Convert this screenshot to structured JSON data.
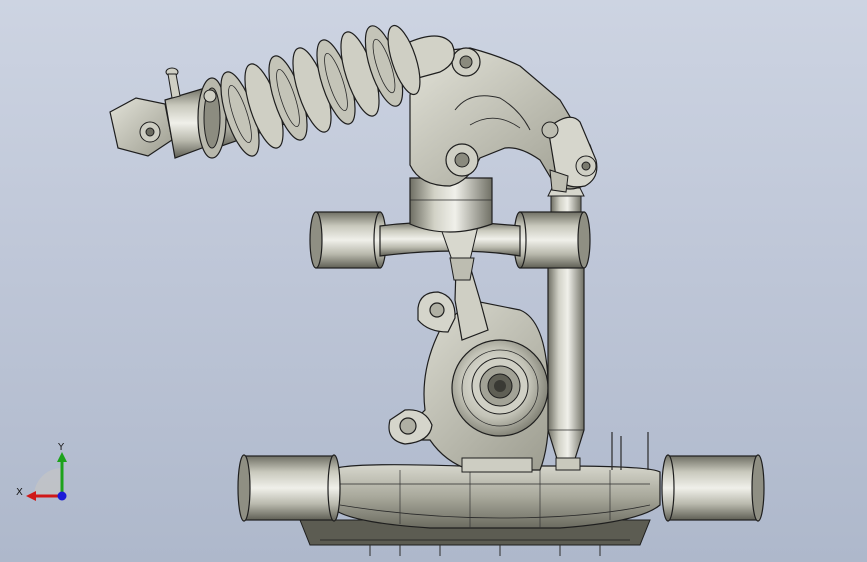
{
  "viewport": {
    "background_top": "#cdd4e2",
    "background_bottom": "#aeb8cb"
  },
  "model": {
    "parts": [
      "shock-absorber",
      "coil-spring",
      "rocker-arm",
      "upper-control-arm",
      "upright-knuckle",
      "wheel-hub",
      "pushrod",
      "lower-control-arm"
    ],
    "metal_light": "#e9e9e2",
    "metal_mid": "#b9b9ad",
    "metal_dark": "#6f6f64",
    "edge_color": "#1e1e1e"
  },
  "triad": {
    "x_label": "X",
    "y_label": "Y",
    "x_color": "#d01818",
    "y_color": "#1ca21c",
    "z_color": "#1a1ad8"
  }
}
